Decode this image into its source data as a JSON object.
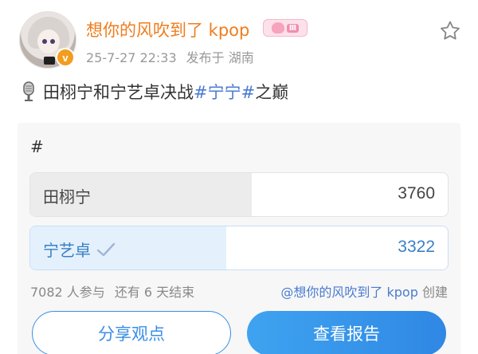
{
  "header": {
    "username": "想你的风吹到了 kpop",
    "verified_badge": "v",
    "level_badge": "Ⅲ",
    "date": "25-7-27 22:33",
    "location": "发布于 湖南"
  },
  "post": {
    "icon": "microphone-icon",
    "text_prefix": "田栩宁和宁艺卓决战",
    "hashtag": "#宁宁#",
    "text_suffix": "之巅"
  },
  "poll": {
    "title": "#",
    "options": [
      {
        "label": "田栩宁",
        "count": "3760",
        "fraction": 0.53,
        "selected": false
      },
      {
        "label": "宁艺卓",
        "count": "3322",
        "fraction": 0.47,
        "selected": true
      }
    ],
    "participants": "7082 人参与",
    "remaining": "还有 6 天结束",
    "creator_name": "@想你的风吹到了 kpop",
    "creator_suffix": "创建",
    "share_label": "分享观点",
    "report_label": "查看报告"
  },
  "colors": {
    "username": "#ef7d1d",
    "hashtag": "#4a7bd0",
    "accent": "#2f88e4",
    "meta": "#999999"
  }
}
